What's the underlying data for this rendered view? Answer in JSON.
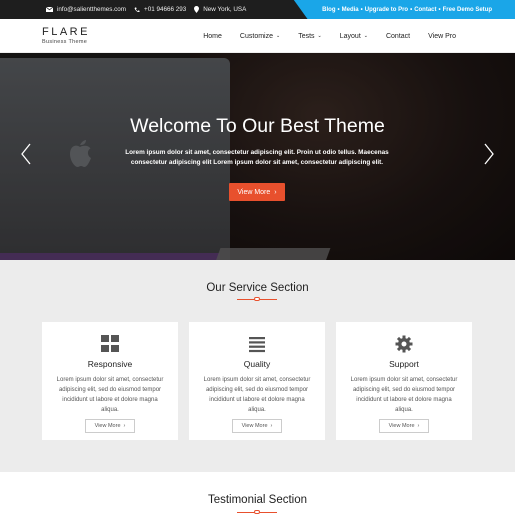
{
  "topbar": {
    "email": "info@salientthemes.com",
    "phone": "+01 94666 293",
    "location": "New York, USA",
    "links": [
      "Blog",
      "Media",
      "Upgrade to Pro",
      "Contact",
      "Free Demo Setup"
    ],
    "separator": "•"
  },
  "logo": {
    "name": "FLARE",
    "tagline": "Business Theme"
  },
  "nav": {
    "items": [
      {
        "label": "Home"
      },
      {
        "label": "Customize"
      },
      {
        "label": "Tests"
      },
      {
        "label": "Layout"
      },
      {
        "label": "Contact"
      },
      {
        "label": "View Pro"
      }
    ],
    "chevron": "⌄"
  },
  "hero": {
    "title": "Welcome To Our Best Theme",
    "text": "Lorem ipsum dolor sit amet, consectetur adipiscing elit. Proin ut odio tellus. Maecenas consectetur adipiscing elit Lorem ipsum dolor sit amet, consectetur adipiscing elit.",
    "button_label": "View More",
    "button_arrow": "›"
  },
  "services": {
    "title": "Our Service Section",
    "cards": [
      {
        "icon": "grid-icon",
        "title": "Responsive",
        "text": "Lorem ipsum dolor sit amet, consectetur adipiscing elit, sed do eiusmod tempor incididunt ut labore et dolore magna aliqua.",
        "button_label": "View More"
      },
      {
        "icon": "bars-icon",
        "title": "Quality",
        "text": "Lorem ipsum dolor sit amet, consectetur adipiscing elit, sed do eiusmod tempor incididunt ut labore et dolore magna aliqua.",
        "button_label": "View More"
      },
      {
        "icon": "gear-icon",
        "title": "Support",
        "text": "Lorem ipsum dolor sit amet, consectetur adipiscing elit, sed do eiusmod tempor incididunt ut labore et dolore magna aliqua.",
        "button_label": "View More"
      }
    ],
    "button_arrow": "›"
  },
  "testimonial": {
    "title": "Testimonial Section"
  },
  "colors": {
    "accent": "#e8502d",
    "topbar_blue": "#1aa6e8",
    "topbar_dark": "#1e1e1e",
    "services_bg": "#ececec"
  }
}
